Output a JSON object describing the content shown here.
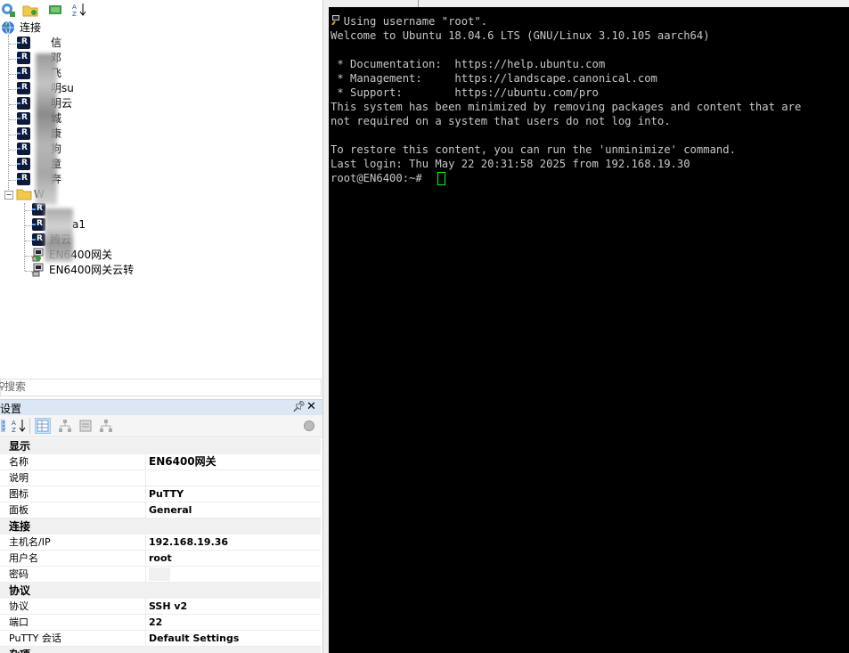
{
  "sidebar": {
    "tree": {
      "root_label": "连接",
      "sessions": [
        {
          "label": "信"
        },
        {
          "label": "邓"
        },
        {
          "label": "飞"
        },
        {
          "label": "明su"
        },
        {
          "label": "明云"
        },
        {
          "label": "城"
        },
        {
          "label": "康"
        },
        {
          "label": "狗"
        },
        {
          "label": "童"
        },
        {
          "label": "奔"
        }
      ],
      "folder_label": "W",
      "folder_sessions": [
        {
          "label": ""
        },
        {
          "label": "a1"
        },
        {
          "label": "腾云"
        },
        {
          "label": "EN6400网关"
        },
        {
          "label": "EN6400网关云转"
        }
      ]
    },
    "search": {
      "placeholder": "搜索"
    }
  },
  "properties": {
    "title": "设置",
    "categories": [
      {
        "name": "显示",
        "rows": [
          {
            "key": "名称",
            "value": "EN6400网关"
          },
          {
            "key": "说明",
            "value": ""
          },
          {
            "key": "图标",
            "value": "PuTTY"
          },
          {
            "key": "面板",
            "value": "General"
          }
        ]
      },
      {
        "name": "连接",
        "rows": [
          {
            "key": "主机名/IP",
            "value": "192.168.19.36"
          },
          {
            "key": "用户名",
            "value": "root"
          },
          {
            "key": "密码",
            "value": ""
          }
        ]
      },
      {
        "name": "协议",
        "rows": [
          {
            "key": "协议",
            "value": "SSH v2"
          },
          {
            "key": "端口",
            "value": "22"
          },
          {
            "key": "PuTTY 会话",
            "value": "Default Settings"
          }
        ]
      }
    ],
    "last_category": "杂项"
  },
  "terminal": {
    "lines": [
      "  Using username \"root\".",
      "Welcome to Ubuntu 18.04.6 LTS (GNU/Linux 3.10.105 aarch64)",
      "",
      " * Documentation:  https://help.ubuntu.com",
      " * Management:     https://landscape.canonical.com",
      " * Support:        https://ubuntu.com/pro",
      "This system has been minimized by removing packages and content that are",
      "not required on a system that users do not log into.",
      "",
      "To restore this content, you can run the 'unminimize' command.",
      "Last login: Thu May 22 20:31:58 2025 from 192.168.19.30",
      "root@EN6400:~# "
    ],
    "text_color": "#c8c8c8",
    "cursor_color": "#00ff00"
  }
}
